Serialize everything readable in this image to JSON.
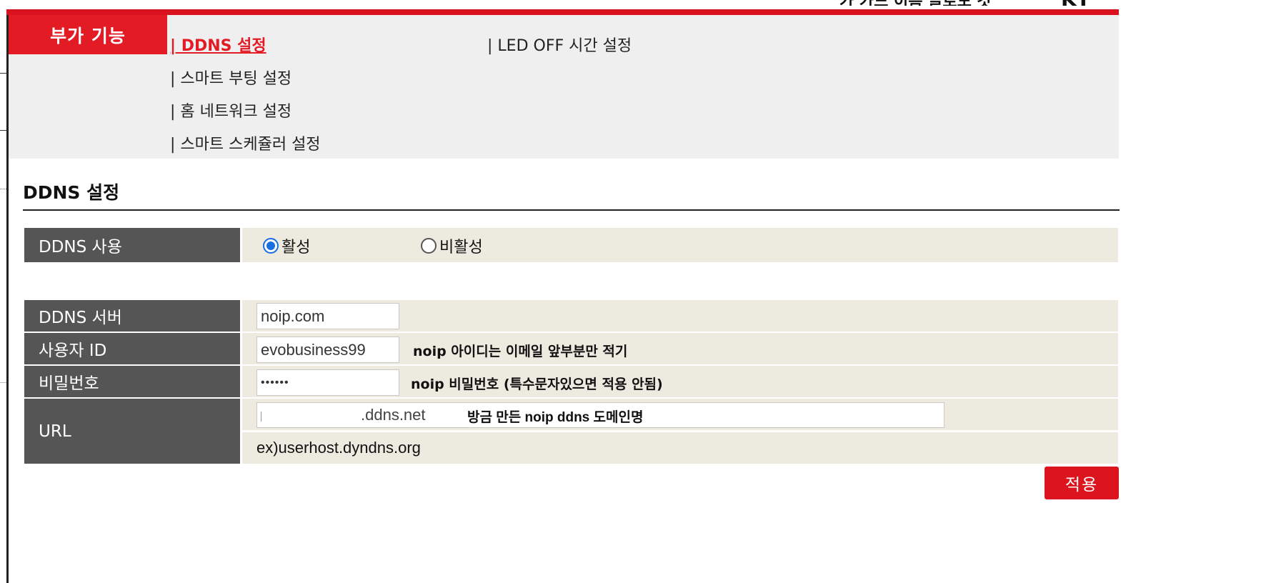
{
  "header": {
    "clipped_text_left": "가 가드 이름 글로도 갓",
    "clipped_text_right": "KT"
  },
  "menu": {
    "section_label": "부가 기능",
    "items": [
      {
        "label": "| DDNS 설정",
        "active": true
      },
      {
        "label": "| LED OFF 시간 설정",
        "active": false
      },
      {
        "label": "| 스마트 부팅 설정",
        "active": false
      },
      {
        "label": "| 홈 네트워크 설정",
        "active": false
      },
      {
        "label": "| 스마트 스케쥴러 설정",
        "active": false
      }
    ]
  },
  "page": {
    "title": "DDNS 설정"
  },
  "form": {
    "ddns_use": {
      "label": "DDNS 사용",
      "options": [
        {
          "label": "활성",
          "checked": true
        },
        {
          "label": "비활성",
          "checked": false
        }
      ]
    },
    "server": {
      "label": "DDNS 서버",
      "value": "noip.com"
    },
    "user_id": {
      "label": "사용자 ID",
      "value": "evobusiness99",
      "hint": "noip 아이디는 이메일 앞부분만 적기"
    },
    "password": {
      "label": "비밀번호",
      "value": "••••••",
      "hint": "noip 비밀번호 (특수문자있으면 적용 안됨)"
    },
    "url": {
      "label": "URL",
      "value_suffix": ".ddns.net",
      "note": "방금 만든 noip ddns 도메인명",
      "example": "ex)userhost.dyndns.org"
    }
  },
  "actions": {
    "apply_label": "적용"
  },
  "colors": {
    "brand_red": "#e31b25",
    "label_bg": "#555555",
    "value_bg": "#edeae0",
    "menu_bg": "#efefef"
  }
}
